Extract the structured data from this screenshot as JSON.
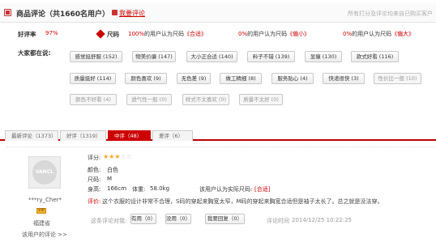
{
  "header": {
    "title": "商品评论（共1660名用户）",
    "write_review": "我要评论",
    "note": "所有打分及评论均来自已购买客户"
  },
  "rates": {
    "good_label": "好评率",
    "good_value": "97%",
    "fit_label": "尺码",
    "fit_items": [
      {
        "pct": "100%",
        "text": "的用户认为尺码",
        "verdict": "《合适》"
      },
      {
        "pct": "0%",
        "text": "的用户认为尺码",
        "verdict": "《偏小》"
      },
      {
        "pct": "0%",
        "text": "的用户认为尺码",
        "verdict": "《偏大》"
      }
    ]
  },
  "tags": {
    "label": "大家都在说:",
    "items": [
      {
        "text": "感觉挺舒服 (152)"
      },
      {
        "text": "物美价廉 (147)"
      },
      {
        "text": "大小正合适 (140)"
      },
      {
        "text": "料子不错 (139)"
      },
      {
        "text": "显瘦 (130)"
      },
      {
        "text": "款式好看 (116)"
      },
      {
        "text": "质量挺好 (114)"
      },
      {
        "text": "颜色喜欢 (9)"
      },
      {
        "text": "无色差 (9)"
      },
      {
        "text": "做工精细 (8)"
      },
      {
        "text": "服务贴心 (4)"
      },
      {
        "text": "快递很快 (3)"
      },
      {
        "text": "性价比一般 (10)"
      },
      {
        "text": "颜色不好看 (4)"
      },
      {
        "text": "透气性一般 (0)"
      },
      {
        "text": "样式不太喜欢 (0)"
      },
      {
        "text": "质量不太好 (0)"
      }
    ]
  },
  "tabs": [
    {
      "label": "最新评论（1373）"
    },
    {
      "label": "好评（1319）"
    },
    {
      "label": "中评（48）"
    },
    {
      "label": "差评（6）"
    }
  ],
  "review": {
    "avatar_text": "VANCL",
    "user": "***ry_Cher*",
    "level": "VIP",
    "location": "福建省",
    "user_reviews_link": "该用户的评论 >>",
    "score_label": "评分:",
    "color_label": "颜色:",
    "color_value": "白色",
    "size_label": "尺码:",
    "size_value": "M",
    "height_label": "身高:",
    "height_value": "166cm",
    "weight_label": "体重:",
    "weight_value": "58.0kg",
    "fit_text": "该用户认为实际尺码:",
    "fit_value": "[合适]",
    "comment_label": "评价:",
    "comment_text": "这个衣服的设计非常不合理，S码的穿起来胸宽太窄，M码的穿起来胸宽合适但是袖子太长了。总之就是没法穿。",
    "rate_prompt": "这条评论对我:",
    "useful": "有用（0）",
    "useless": "没用（0）",
    "reply": "我要回复（0）",
    "time_label": "评论时间",
    "time_value": "2014/12/25 10:22:25"
  }
}
